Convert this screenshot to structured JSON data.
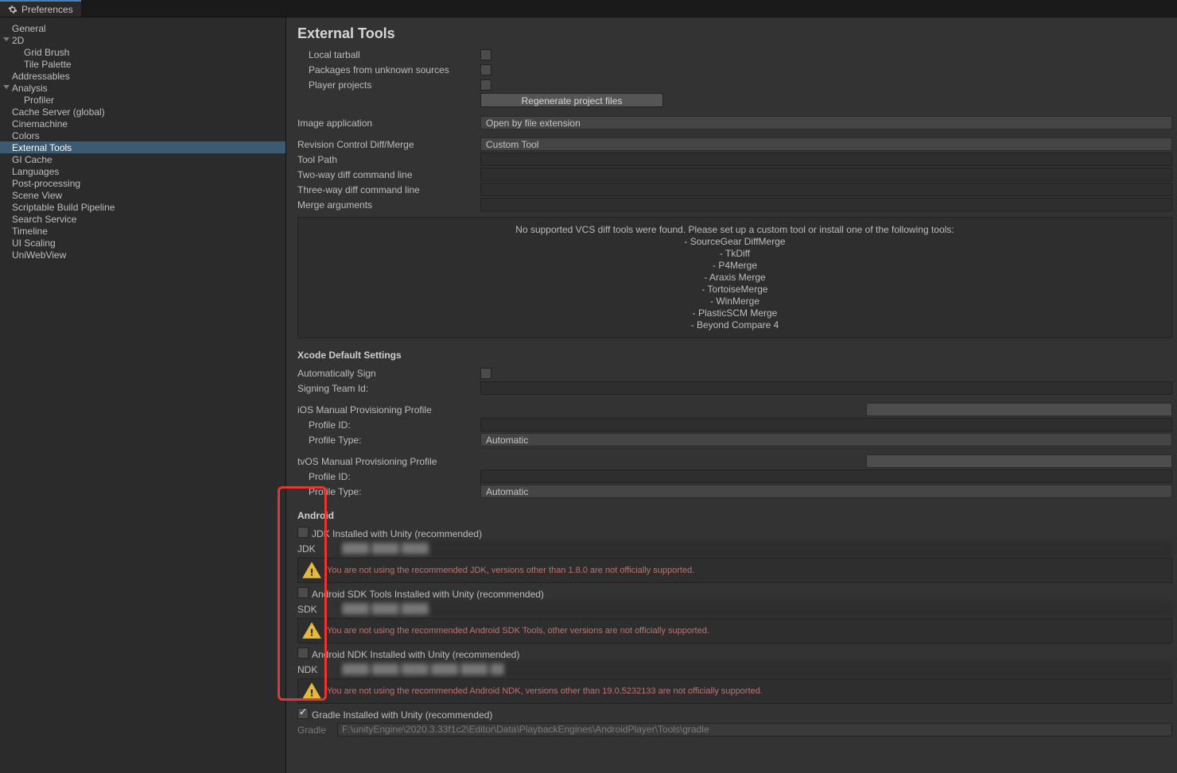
{
  "tab": {
    "title": "Preferences"
  },
  "sidebar": {
    "items": [
      {
        "label": "General",
        "cls": "",
        "ind": 0
      },
      {
        "label": "2D",
        "cls": "sb-fold",
        "ind": 0
      },
      {
        "label": "Grid Brush",
        "cls": "",
        "ind": 2
      },
      {
        "label": "Tile Palette",
        "cls": "",
        "ind": 2
      },
      {
        "label": "Addressables",
        "cls": "",
        "ind": 0
      },
      {
        "label": "Analysis",
        "cls": "sb-fold",
        "ind": 0
      },
      {
        "label": "Profiler",
        "cls": "",
        "ind": 2
      },
      {
        "label": "Cache Server (global)",
        "cls": "",
        "ind": 0
      },
      {
        "label": "Cinemachine",
        "cls": "",
        "ind": 0
      },
      {
        "label": "Colors",
        "cls": "",
        "ind": 0
      },
      {
        "label": "External Tools",
        "cls": "selected",
        "ind": 0
      },
      {
        "label": "GI Cache",
        "cls": "",
        "ind": 0
      },
      {
        "label": "Languages",
        "cls": "",
        "ind": 0
      },
      {
        "label": "Post-processing",
        "cls": "",
        "ind": 0
      },
      {
        "label": "Scene View",
        "cls": "",
        "ind": 0
      },
      {
        "label": "Scriptable Build Pipeline",
        "cls": "",
        "ind": 0
      },
      {
        "label": "Search Service",
        "cls": "",
        "ind": 0
      },
      {
        "label": "Timeline",
        "cls": "",
        "ind": 0
      },
      {
        "label": "UI Scaling",
        "cls": "",
        "ind": 0
      },
      {
        "label": "UniWebView",
        "cls": "",
        "ind": 0
      }
    ]
  },
  "main": {
    "title": "External Tools",
    "packages": {
      "local_tarball": "Local tarball",
      "unknown_sources": "Packages from unknown sources",
      "player_projects": "Player projects",
      "regenerate": "Regenerate project files"
    },
    "image_app_label": "Image application",
    "image_app_value": "Open by file extension",
    "rc_label": "Revision Control Diff/Merge",
    "rc_value": "Custom Tool",
    "tool_path": "Tool Path",
    "two_way": "Two-way diff command line",
    "three_way": "Three-way diff command line",
    "merge_args": "Merge arguments",
    "vcs_note": {
      "l0": "No supported VCS diff tools were found. Please set up a custom tool or install one of the following tools:",
      "l1": "- SourceGear DiffMerge",
      "l2": "- TkDiff",
      "l3": "- P4Merge",
      "l4": "- Araxis Merge",
      "l5": "- TortoiseMerge",
      "l6": "- WinMerge",
      "l7": "- PlasticSCM Merge",
      "l8": "- Beyond Compare 4"
    },
    "xcode": {
      "head": "Xcode Default Settings",
      "auto_sign": "Automatically Sign",
      "team_id": "Signing Team Id:",
      "ios_head": "iOS Manual Provisioning Profile",
      "tvos_head": "tvOS Manual Provisioning Profile",
      "profile_id": "Profile ID:",
      "profile_type": "Profile Type:",
      "profile_value": "Automatic"
    },
    "android": {
      "head": "Android",
      "jdk_chk": "JDK Installed with Unity (recommended)",
      "jdk_lbl": "JDK",
      "jdk_warn": "You are not using the recommended JDK, versions other than 1.8.0 are not officially supported.",
      "sdk_chk": "Android SDK Tools Installed with Unity (recommended)",
      "sdk_lbl": "SDK",
      "sdk_warn": "You are not using the recommended Android SDK Tools, other versions are not officially supported.",
      "ndk_chk": "Android NDK Installed with Unity (recommended)",
      "ndk_lbl": "NDK",
      "ndk_warn": "You are not using the recommended Android NDK, versions other than 19.0.5232133 are not officially supported.",
      "gradle_chk": "Gradle Installed with Unity (recommended)",
      "gradle_lbl": "Gradle",
      "gradle_path": "F:\\unityEngine\\2020.3.33f1c2\\Editor\\Data\\PlaybackEngines\\AndroidPlayer\\Tools\\gradle"
    }
  }
}
